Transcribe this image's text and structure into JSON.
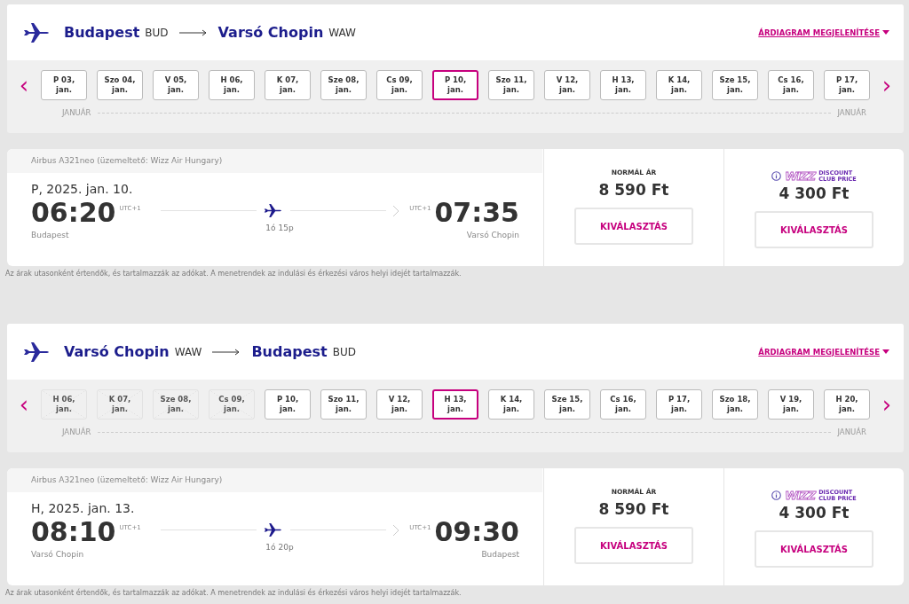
{
  "sections": [
    {
      "route": {
        "from_city": "Budapest",
        "from_code": "BUD",
        "to_city": "Varsó Chopin",
        "to_code": "WAW"
      },
      "chart_link": "ÁRDIAGRAM MEGJELENÍTÉSE",
      "prev": "‹",
      "next": "›",
      "dates": [
        {
          "day": "P 03,",
          "month": "jan.",
          "selected": false,
          "disabled": false
        },
        {
          "day": "Szo 04,",
          "month": "jan.",
          "selected": false,
          "disabled": false
        },
        {
          "day": "V 05,",
          "month": "jan.",
          "selected": false,
          "disabled": false
        },
        {
          "day": "H 06,",
          "month": "jan.",
          "selected": false,
          "disabled": false
        },
        {
          "day": "K 07,",
          "month": "jan.",
          "selected": false,
          "disabled": false
        },
        {
          "day": "Sze 08,",
          "month": "jan.",
          "selected": false,
          "disabled": false
        },
        {
          "day": "Cs 09,",
          "month": "jan.",
          "selected": false,
          "disabled": false
        },
        {
          "day": "P 10,",
          "month": "jan.",
          "selected": true,
          "disabled": false
        },
        {
          "day": "Szo 11,",
          "month": "jan.",
          "selected": false,
          "disabled": false
        },
        {
          "day": "V 12,",
          "month": "jan.",
          "selected": false,
          "disabled": false
        },
        {
          "day": "H 13,",
          "month": "jan.",
          "selected": false,
          "disabled": false
        },
        {
          "day": "K 14,",
          "month": "jan.",
          "selected": false,
          "disabled": false
        },
        {
          "day": "Sze 15,",
          "month": "jan.",
          "selected": false,
          "disabled": false
        },
        {
          "day": "Cs 16,",
          "month": "jan.",
          "selected": false,
          "disabled": false
        },
        {
          "day": "P 17,",
          "month": "jan.",
          "selected": false,
          "disabled": false
        }
      ],
      "month_left": "JANUÁR",
      "month_right": "JANUÁR",
      "flight": {
        "aircraft": "Airbus A321neo (üzemeltető: Wizz Air Hungary)",
        "date": "P, 2025. jan. 10.",
        "departure": {
          "time": "06:20",
          "tz": "UTC+1",
          "city": "Budapest"
        },
        "arrival": {
          "time": "07:35",
          "tz": "UTC+1",
          "city": "Varsó Chopin"
        },
        "duration": "1ó 15p",
        "fares": [
          {
            "kind": "normal",
            "label": "NORMÁL ÁR",
            "price": "8 590 Ft",
            "button": "KIVÁLASZTÁS"
          },
          {
            "kind": "club",
            "brand": "WIZZ",
            "label_lines": [
              "DISCOUNT",
              "CLUB PRICE"
            ],
            "price": "4 300 Ft",
            "button": "KIVÁLASZTÁS"
          }
        ]
      },
      "note": "Az árak utasonként értendők, és tartalmazzák az adókat. A menetrendek az indulási és érkezési város helyi idejét tartalmazzák."
    },
    {
      "route": {
        "from_city": "Varsó Chopin",
        "from_code": "WAW",
        "to_city": "Budapest",
        "to_code": "BUD"
      },
      "chart_link": "ÁRDIAGRAM MEGJELENÍTÉSE",
      "prev": "‹",
      "next": "›",
      "dates": [
        {
          "day": "H 06,",
          "month": "jan.",
          "selected": false,
          "disabled": true
        },
        {
          "day": "K 07,",
          "month": "jan.",
          "selected": false,
          "disabled": true
        },
        {
          "day": "Sze 08,",
          "month": "jan.",
          "selected": false,
          "disabled": true
        },
        {
          "day": "Cs 09,",
          "month": "jan.",
          "selected": false,
          "disabled": true
        },
        {
          "day": "P 10,",
          "month": "jan.",
          "selected": false,
          "disabled": false
        },
        {
          "day": "Szo 11,",
          "month": "jan.",
          "selected": false,
          "disabled": false
        },
        {
          "day": "V 12,",
          "month": "jan.",
          "selected": false,
          "disabled": false
        },
        {
          "day": "H 13,",
          "month": "jan.",
          "selected": true,
          "disabled": false
        },
        {
          "day": "K 14,",
          "month": "jan.",
          "selected": false,
          "disabled": false
        },
        {
          "day": "Sze 15,",
          "month": "jan.",
          "selected": false,
          "disabled": false
        },
        {
          "day": "Cs 16,",
          "month": "jan.",
          "selected": false,
          "disabled": false
        },
        {
          "day": "P 17,",
          "month": "jan.",
          "selected": false,
          "disabled": false
        },
        {
          "day": "Szo 18,",
          "month": "jan.",
          "selected": false,
          "disabled": false
        },
        {
          "day": "V 19,",
          "month": "jan.",
          "selected": false,
          "disabled": false
        },
        {
          "day": "H 20,",
          "month": "jan.",
          "selected": false,
          "disabled": false
        }
      ],
      "month_left": "JANUÁR",
      "month_right": "JANUÁR",
      "flight": {
        "aircraft": "Airbus A321neo (üzemeltető: Wizz Air Hungary)",
        "date": "H, 2025. jan. 13.",
        "departure": {
          "time": "08:10",
          "tz": "UTC+1",
          "city": "Varsó Chopin"
        },
        "arrival": {
          "time": "09:30",
          "tz": "UTC+1",
          "city": "Budapest"
        },
        "duration": "1ó 20p",
        "fares": [
          {
            "kind": "normal",
            "label": "NORMÁL ÁR",
            "price": "8 590 Ft",
            "button": "KIVÁLASZTÁS"
          },
          {
            "kind": "club",
            "brand": "WIZZ",
            "label_lines": [
              "DISCOUNT",
              "CLUB PRICE"
            ],
            "price": "4 300 Ft",
            "button": "KIVÁLASZTÁS"
          }
        ]
      },
      "note": "Az árak utasonként értendők, és tartalmazzák az adókat. A menetrendek az indulási és érkezési város helyi idejét tartalmazzák."
    }
  ]
}
